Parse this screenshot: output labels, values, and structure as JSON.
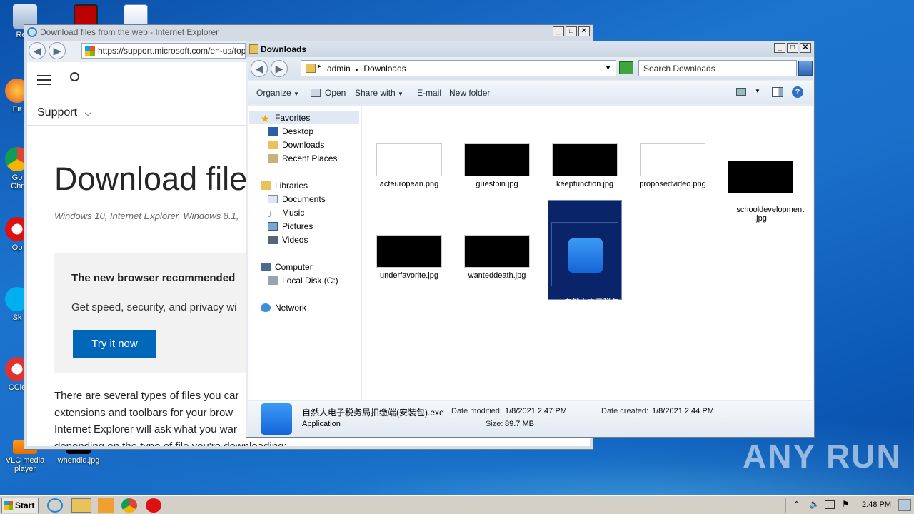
{
  "desktop": {
    "icons": [
      {
        "label": "Recy"
      },
      {
        "label": "Fir"
      },
      {
        "label": "Go\nChr"
      },
      {
        "label": "Op"
      },
      {
        "label": "Sk"
      },
      {
        "label": "CCle"
      },
      {
        "label": "VLC media\nplayer"
      },
      {
        "label": "whendid.jpg"
      }
    ],
    "watermark": "ANY RUN"
  },
  "ie": {
    "title": "Download files from the web - Internet Explorer",
    "address": "https://support.microsoft.com/en-us/topic",
    "nav_support": "Support",
    "heading": "Download files",
    "subtitle": "Windows 10, Internet Explorer, Windows 8.1,",
    "promo_title": "The new browser recommended",
    "promo_text": "Get speed, security, and privacy wi",
    "try_button": "Try it now",
    "body_lines": [
      "There are several types of files you car",
      "extensions and toolbars for your brow",
      "Internet Explorer will ask what you war",
      "depending on the type of file you're downloading:"
    ]
  },
  "explorer": {
    "title": "Downloads",
    "breadcrumb": [
      "admin",
      "Downloads"
    ],
    "search_placeholder": "Search Downloads",
    "toolbar": {
      "organize": "Organize",
      "open": "Open",
      "share": "Share with",
      "email": "E-mail",
      "new_folder": "New folder"
    },
    "tree": {
      "favorites": "Favorites",
      "desktop": "Desktop",
      "downloads": "Downloads",
      "recent": "Recent Places",
      "libraries": "Libraries",
      "documents": "Documents",
      "music": "Music",
      "pictures": "Pictures",
      "videos": "Videos",
      "computer": "Computer",
      "local_disk": "Local Disk (C:)",
      "network": "Network"
    },
    "files": [
      {
        "name": "acteuropean.png"
      },
      {
        "name": "guestbin.jpg"
      },
      {
        "name": "keepfunction.jpg"
      },
      {
        "name": "proposedvideo.png"
      },
      {
        "name": "schooldevelopment\n.jpg"
      },
      {
        "name": "underfavorite.jpg"
      },
      {
        "name": "wanteddeath.jpg"
      },
      {
        "name": "自然人电子税务\n局扣缴端(安装\n包).exe"
      }
    ],
    "details": {
      "filename": "自然人电子税务局扣缴端(安装包).exe",
      "type": "Application",
      "modified_label": "Date modified:",
      "modified": "1/8/2021 2:47 PM",
      "size_label": "Size:",
      "size": "89.7 MB",
      "created_label": "Date created:",
      "created": "1/8/2021 2:44 PM"
    }
  },
  "taskbar": {
    "start": "Start",
    "clock": "2:48 PM"
  },
  "colors": {
    "selection": "#0a246a",
    "try_button": "#0067b8",
    "ie_accent": "#1e88d8"
  }
}
